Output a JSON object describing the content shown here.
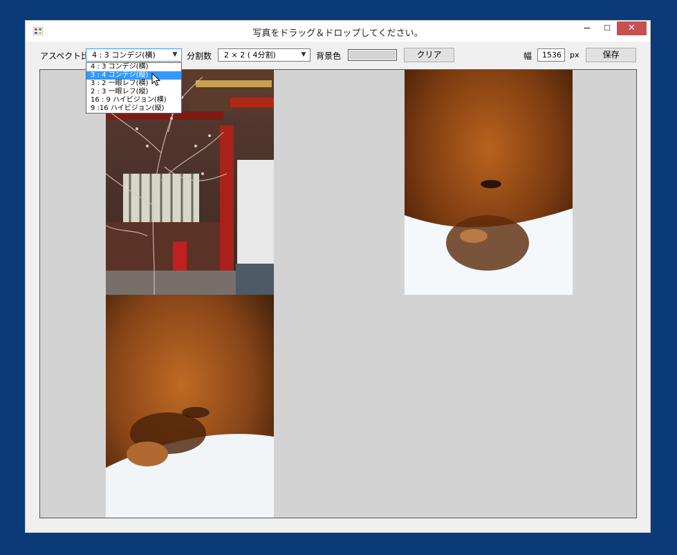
{
  "window": {
    "title": "写真をドラッグ＆ドロップしてください。",
    "controls": {
      "minimize": "−",
      "maximize": "☐",
      "close": "✕"
    }
  },
  "toolbar": {
    "aspect_label": "アスペクト比",
    "aspect_selected": "4 : 3 コンデジ(横)",
    "divisions_label": "分割数",
    "divisions_selected": "2 × 2 ( 4分割)",
    "bgcolor_label": "背景色",
    "bgcolor_value": "#d3d3d3",
    "clear_label": "クリア",
    "width_label": "幅",
    "width_value": "1536",
    "width_unit": "px",
    "save_label": "保存"
  },
  "aspect_dropdown": {
    "options": [
      "4 : 3 コンデジ(横)",
      "3 : 4 コンデジ(縦)",
      "3 : 2 一眼レフ(横)",
      "2 : 3 一眼レフ(縦)",
      "16 : 9 ハイビジョン(横)",
      "9 :16 ハイビジョン(縦)"
    ],
    "highlighted_index": 1
  },
  "colors": {
    "desktop": "#0b3a78",
    "close_button": "#c75050",
    "highlight": "#3399ff",
    "canvas": "#d3d3d3"
  },
  "icons": {
    "app": "app-icon",
    "combo_arrow": "chevron-down-icon",
    "cursor": "mouse-pointer-icon"
  }
}
